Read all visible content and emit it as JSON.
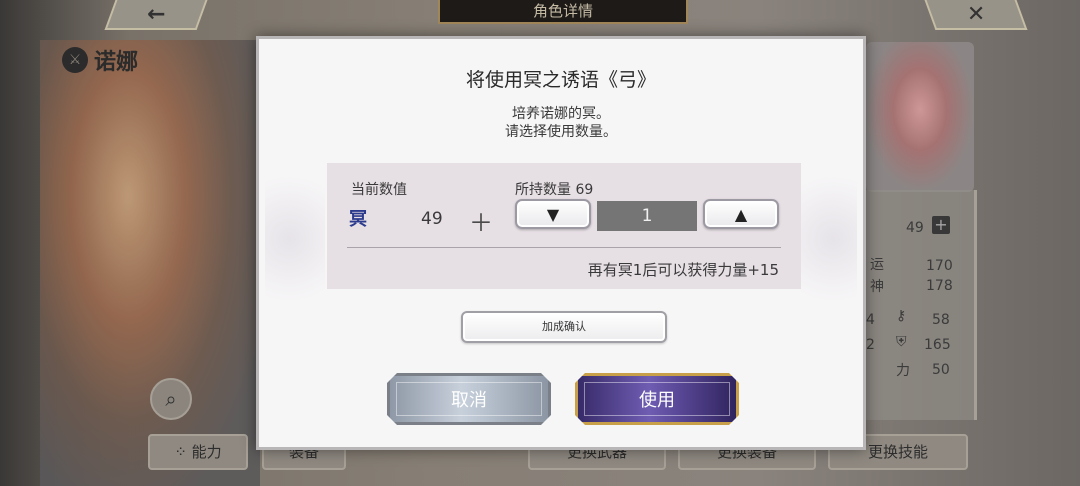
{
  "header": {
    "title": "角色详情",
    "back_icon": "←",
    "close_icon": "✕"
  },
  "character": {
    "name": "诺娜"
  },
  "right_panel": {
    "stat_value": "49",
    "rows": [
      {
        "label": "运",
        "value": "170"
      },
      {
        "label": "神",
        "value": "178"
      },
      {
        "label": "4",
        "value": "58"
      },
      {
        "label": "2",
        "value": "165"
      },
      {
        "label": "力",
        "value": "50"
      }
    ]
  },
  "bottom_tabs": {
    "ability": "能力",
    "equipment": "装备",
    "change_weapon": "更换武器",
    "change_gear": "更换装备",
    "change_skill": "更换技能"
  },
  "dialog": {
    "title": "将使用冥之诱语《弓》",
    "desc_line1": "培养诺娜的冥。",
    "desc_line2": "请选择使用数量。",
    "current_label": "当前数值",
    "held_label": "所持数量 69",
    "stat_symbol": "冥",
    "current_value": "49",
    "plus": "＋",
    "decrease_symbol": "▼",
    "increase_symbol": "▲",
    "quantity": "1",
    "result_text": "再有冥1后可以获得力量+15",
    "confirm_label": "加成确认",
    "cancel_label": "取消",
    "use_label": "使用"
  },
  "colors": {
    "use_button": "#5d4b9c",
    "use_border": "#c8a04a",
    "cancel_button": "#b8c2ce",
    "info_box": "#e6dfe4",
    "stat_icon": "#2b3a8c"
  }
}
